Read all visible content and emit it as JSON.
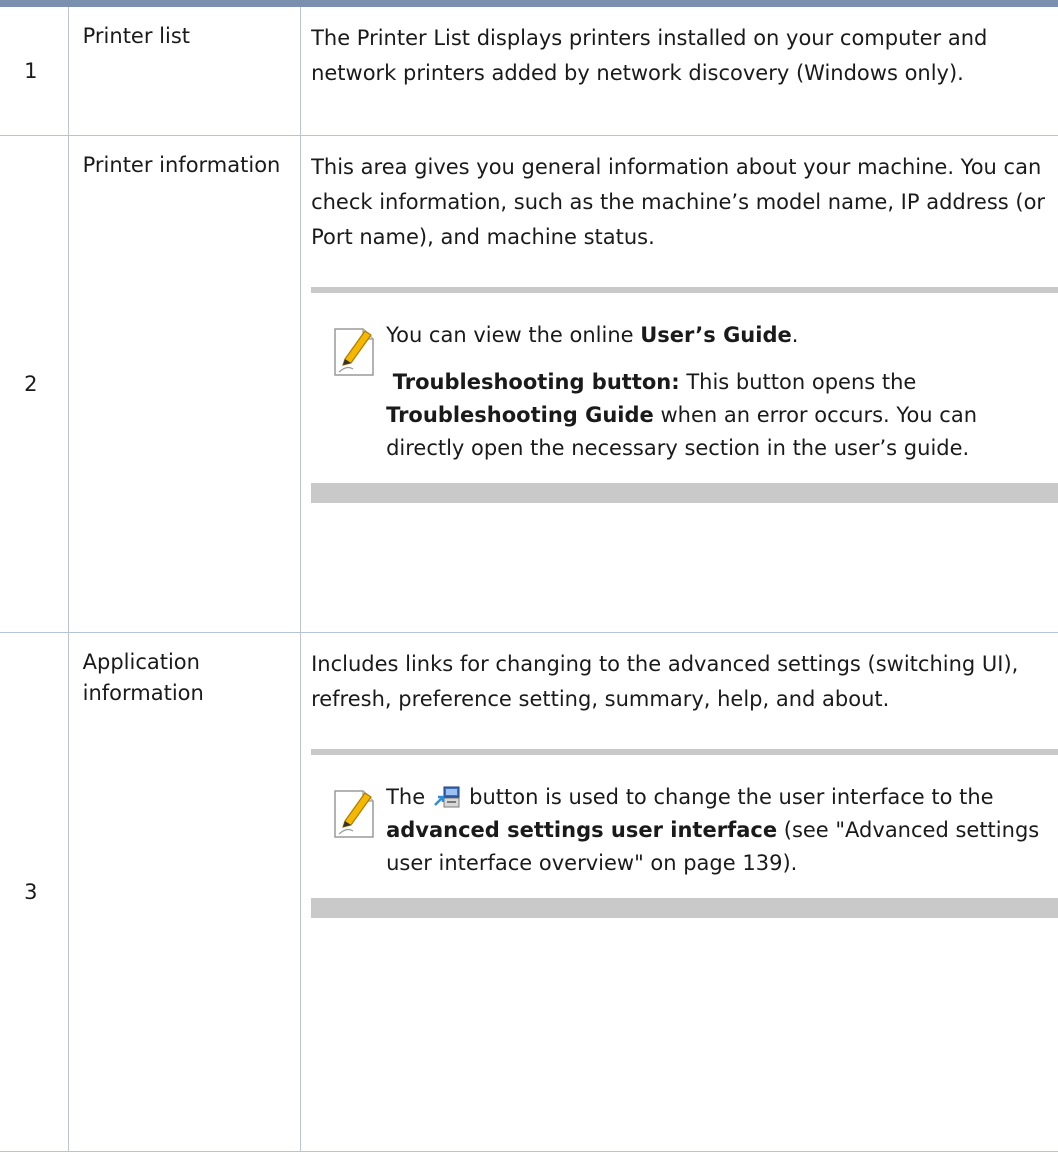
{
  "rows": [
    {
      "number": "1",
      "title": "Printer list",
      "description": "The Printer List displays printers installed on your computer and network printers added by network discovery (Windows only)."
    },
    {
      "number": "2",
      "title": "Printer information",
      "description": "This area gives you general information about your machine. You can check information, such as the machine’s model name, IP address (or Port name), and machine status.",
      "note": {
        "icon": "note-pencil-icon",
        "line1_prefix": "You can view the online ",
        "line1_bold": "User’s Guide",
        "line1_suffix": ".",
        "line2_bold1": "Troubleshooting button:",
        "line2_text1": " This button opens the ",
        "line2_bold2": "Troubleshooting Guide",
        "line2_text2": " when an error occurs. You can directly open the necessary section in the user’s guide."
      }
    },
    {
      "number": "3",
      "title": "Application information",
      "description": "Includes links for changing to the advanced settings (switching UI), refresh, preference setting, summary, help, and about.",
      "note": {
        "icon": "note-pencil-icon",
        "prefix": "The",
        "button_icon": "switch-ui-icon",
        "text1": "button is used to change the user interface to the ",
        "bold": "advanced settings user interface",
        "text2": " (see \"Advanced settings user interface overview\" on page 139)."
      }
    }
  ],
  "colors": {
    "header_bar": "#7b8fae",
    "grid": "#b7c3d6",
    "note_bar": "#c9c9c9",
    "pencil": "#f5b800"
  }
}
